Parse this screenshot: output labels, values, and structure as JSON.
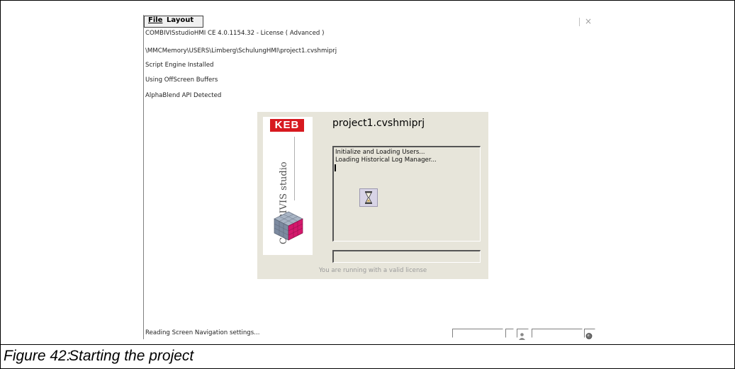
{
  "menu": {
    "file": "File",
    "layout": "Layout",
    "close": "×"
  },
  "log_lines": [
    "COMBIVISstudioHMI CE 4.0.1154.32 - License ( Advanced )",
    "\\MMCMemory\\USERS\\Limberg\\SchulungHMI\\project1.cvshmiprj",
    "Script Engine Installed",
    "Using OffScreen Buffers",
    "AlphaBlend API Detected"
  ],
  "splash": {
    "brand": "KEB",
    "product_vertical": "COMBIVIS studio",
    "project_title": "project1.cvshmiprj",
    "log": [
      "Initialize and Loading Users...",
      "Loading Historical Log Manager..."
    ],
    "license_text": "You are running with a valid license",
    "icons": {
      "wait": "hourglass-icon"
    }
  },
  "status": {
    "text": "Reading Screen Navigation settings...",
    "icons": [
      "user-icon",
      "record-icon"
    ]
  },
  "caption": {
    "number": "Figure 42:",
    "text": "Starting the project"
  },
  "colors": {
    "keb_red": "#d7191f",
    "splash_bg": "#e7e5da",
    "magenta": "#d4186c"
  }
}
